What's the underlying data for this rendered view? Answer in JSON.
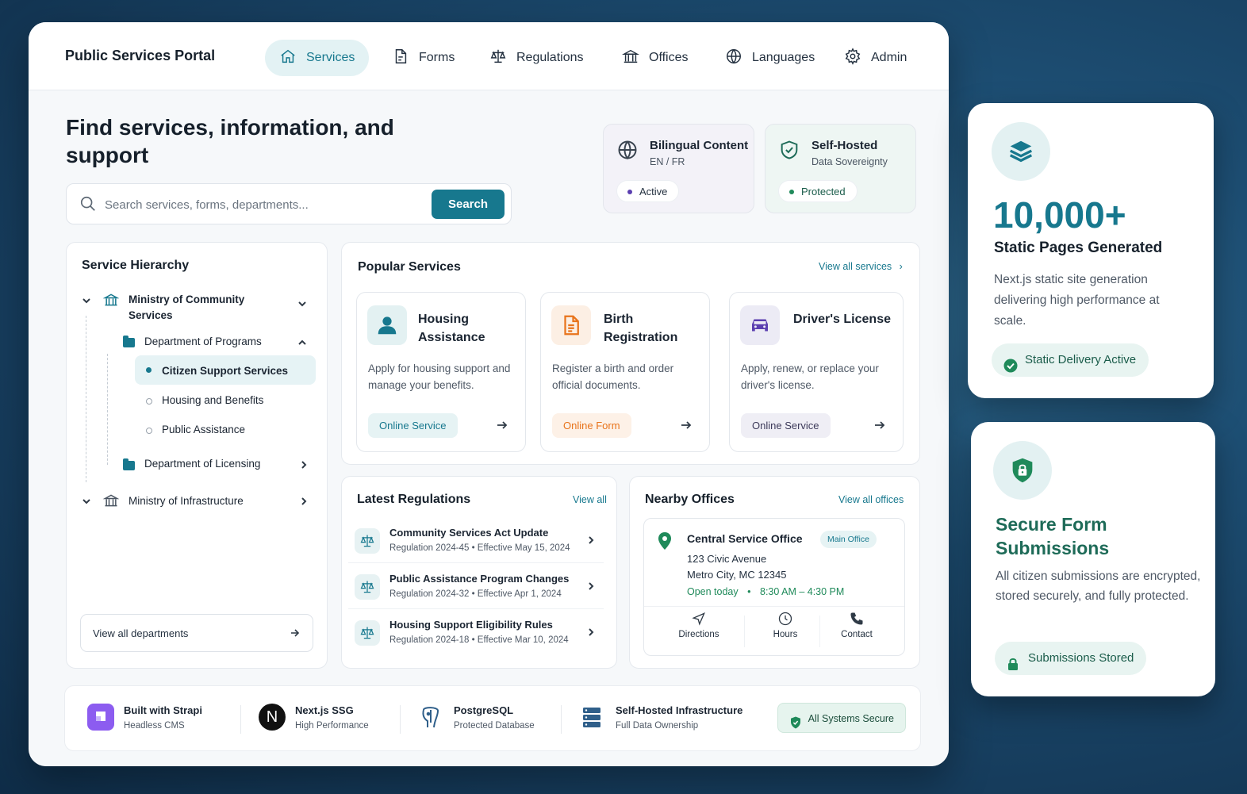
{
  "app": {
    "brand": "Public Services Portal"
  },
  "nav": {
    "items": [
      {
        "label": "Services",
        "icon": "home-icon"
      },
      {
        "label": "Forms",
        "icon": "document-icon"
      },
      {
        "label": "Regulations",
        "icon": "scale-icon"
      },
      {
        "label": "Offices",
        "icon": "building-icon"
      },
      {
        "label": "Languages",
        "icon": "globe-icon"
      },
      {
        "label": "Admin",
        "icon": "gear-icon"
      }
    ]
  },
  "hero": {
    "title": "Find services, information, and support",
    "search_placeholder": "Search services, forms, departments...",
    "search_button": "Search"
  },
  "badges": {
    "bilingual": {
      "title": "Bilingual Content",
      "sub": "EN / FR",
      "status": "Active"
    },
    "selfhosted": {
      "title": "Self-Hosted",
      "sub": "Data Sovereignty",
      "status": "Protected"
    }
  },
  "hierarchy": {
    "title": "Service Hierarchy",
    "ministry1": "Ministry of Community Services",
    "dept1": "Department of Programs",
    "leaf1": "Citizen Support Services",
    "leaf2": "Housing and Benefits",
    "leaf3": "Public Assistance",
    "dept2": "Department of Licensing",
    "ministry2": "Ministry of Infrastructure",
    "view_all": "View all departments"
  },
  "popular": {
    "title": "Popular Services",
    "view_all": "View all services",
    "cards": [
      {
        "title": "Housing Assistance",
        "desc": "Apply for housing support and manage your benefits.",
        "tag": "Online Service"
      },
      {
        "title": "Birth Registration",
        "desc": "Register a birth and order official documents.",
        "tag": "Online Form"
      },
      {
        "title": "Driver's License",
        "desc": "Apply, renew, or replace your driver's license.",
        "tag": "Online Service"
      }
    ]
  },
  "regulations": {
    "title": "Latest Regulations",
    "view_all": "View all",
    "items": [
      {
        "title": "Community Services Act Update",
        "sub": "Regulation 2024-45  •  Effective May 15, 2024"
      },
      {
        "title": "Public Assistance Program Changes",
        "sub": "Regulation 2024-32  •  Effective Apr 1, 2024"
      },
      {
        "title": "Housing Support Eligibility Rules",
        "sub": "Regulation 2024-18  •  Effective Mar 10, 2024"
      }
    ]
  },
  "offices": {
    "title": "Nearby Offices",
    "view_all": "View all offices",
    "name": "Central Service Office",
    "badge": "Main Office",
    "address1": "123 Civic Avenue",
    "address2": "Metro City, MC 12345",
    "open": "Open today",
    "hours": "8:30 AM – 4:30 PM",
    "actions": [
      "Directions",
      "Hours",
      "Contact"
    ]
  },
  "footer": {
    "items": [
      {
        "title": "Built with Strapi",
        "sub": "Headless CMS"
      },
      {
        "title": "Next.js SSG",
        "sub": "High Performance"
      },
      {
        "title": "PostgreSQL",
        "sub": "Protected Database"
      },
      {
        "title": "Self-Hosted Infrastructure",
        "sub": "Full Data Ownership"
      }
    ],
    "status": "All Systems Secure",
    "next_glyph": "N"
  },
  "side": {
    "stat": {
      "value": "10,000+",
      "label": "Static Pages Generated",
      "desc": "Next.js static site generation delivering high performance at scale.",
      "pill": "Static Delivery Active"
    },
    "secure": {
      "title": "Secure Form Submissions",
      "desc": "All citizen submissions are encrypted, stored securely, and fully protected.",
      "pill": "Submissions Stored"
    }
  },
  "colors": {
    "accent": "#17788e",
    "orange": "#e8741c",
    "purple": "#5b3fb0",
    "green": "#1f8a5a"
  }
}
